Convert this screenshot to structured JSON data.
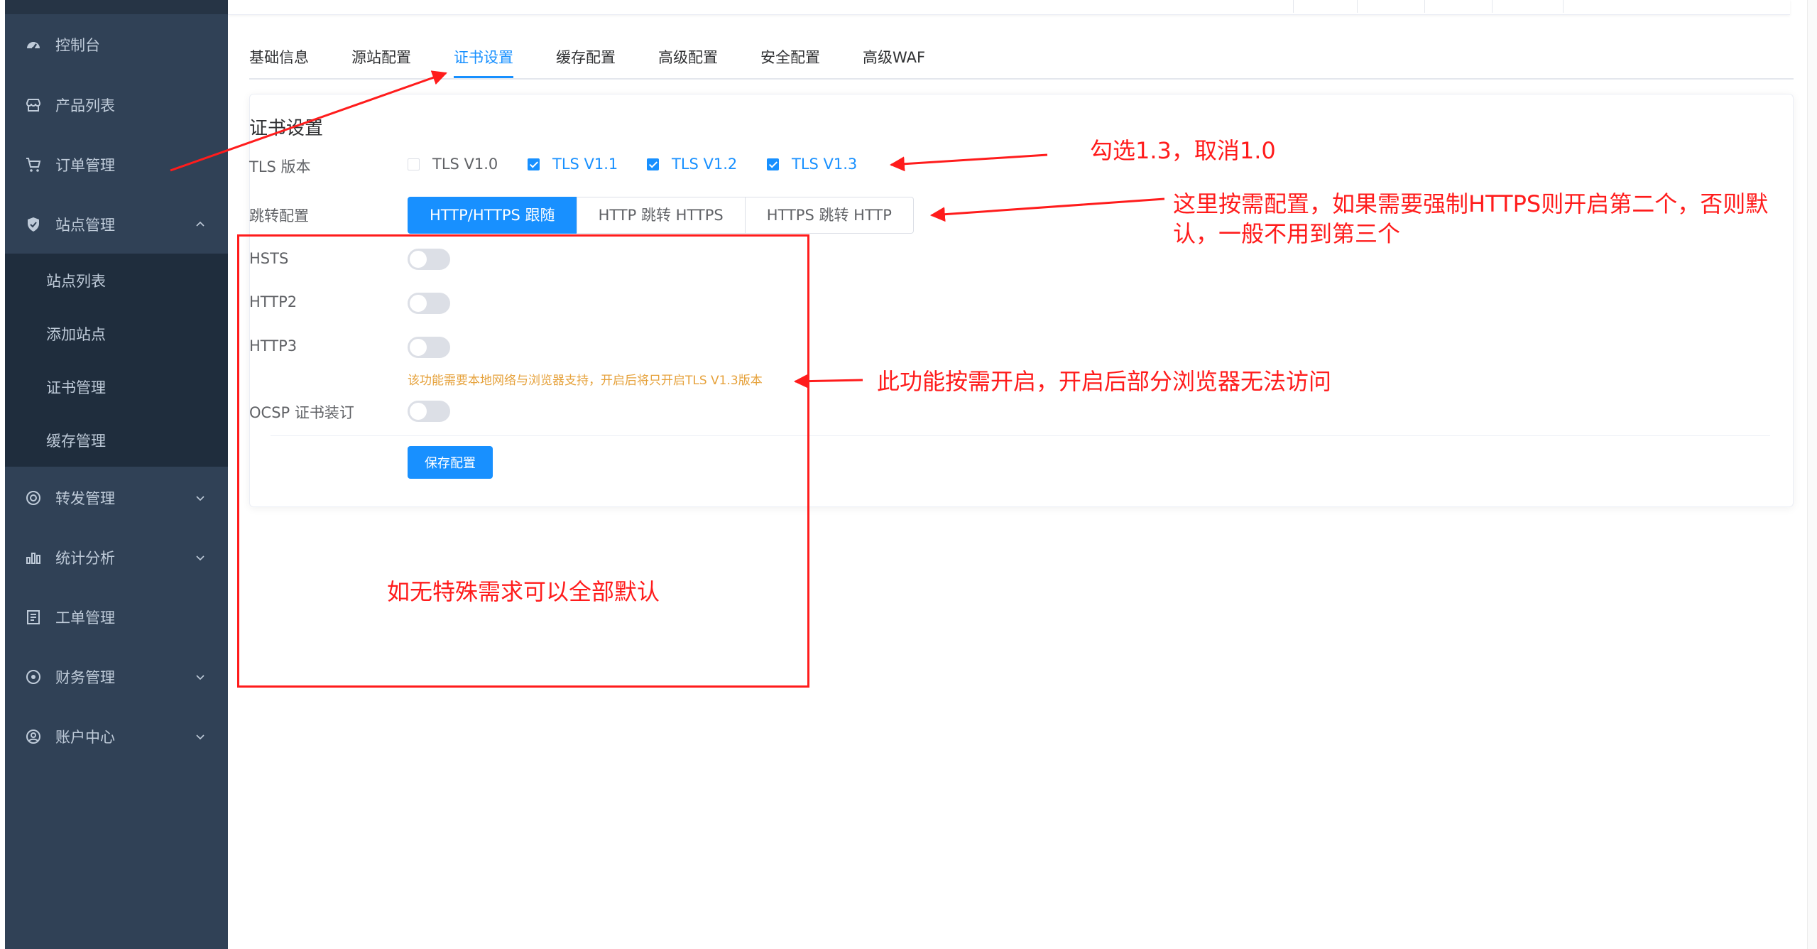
{
  "sidebar": {
    "items": [
      {
        "label": "控制台",
        "icon": "dashboard-icon"
      },
      {
        "label": "产品列表",
        "icon": "shop-icon"
      },
      {
        "label": "订单管理",
        "icon": "cart-icon"
      },
      {
        "label": "站点管理",
        "icon": "shield-icon",
        "arrow": "chevron-up-icon"
      },
      {
        "label": "转发管理",
        "icon": "target-icon",
        "arrow": "chevron-down-icon"
      },
      {
        "label": "统计分析",
        "icon": "bar-chart-icon",
        "arrow": "chevron-down-icon"
      },
      {
        "label": "工单管理",
        "icon": "document-icon"
      },
      {
        "label": "财务管理",
        "icon": "compass-icon",
        "arrow": "chevron-down-icon"
      },
      {
        "label": "账户中心",
        "icon": "user-circle-icon",
        "arrow": "chevron-down-icon"
      }
    ],
    "submenu": [
      {
        "label": "站点列表"
      },
      {
        "label": "添加站点"
      },
      {
        "label": "证书管理"
      },
      {
        "label": "缓存管理"
      }
    ]
  },
  "tabs": [
    {
      "label": "基础信息"
    },
    {
      "label": "源站配置"
    },
    {
      "label": "证书设置",
      "active": true
    },
    {
      "label": "缓存配置"
    },
    {
      "label": "高级配置"
    },
    {
      "label": "安全配置"
    },
    {
      "label": "高级WAF"
    }
  ],
  "form": {
    "title": "证书设置",
    "tls_label": "TLS 版本",
    "tls_options": [
      {
        "label": "TLS V1.0",
        "checked": false
      },
      {
        "label": "TLS V1.1",
        "checked": true
      },
      {
        "label": "TLS V1.2",
        "checked": true
      },
      {
        "label": "TLS V1.3",
        "checked": true
      }
    ],
    "redirect_label": "跳转配置",
    "redirect_options": [
      {
        "label": "HTTP/HTTPS 跟随",
        "active": true
      },
      {
        "label": "HTTP 跳转 HTTPS",
        "active": false
      },
      {
        "label": "HTTPS 跳转 HTTP",
        "active": false
      }
    ],
    "hsts_label": "HSTS",
    "hsts_on": false,
    "http2_label": "HTTP2",
    "http2_on": false,
    "http3_label": "HTTP3",
    "http3_on": false,
    "http3_tip": "该功能需要本地网络与浏览器支持，开启后将只开启TLS V1.3版本",
    "ocsp_label": "OCSP 证书装订",
    "ocsp_on": false,
    "save_label": "保存配置"
  },
  "annotations": {
    "tls_note": "勾选1.3，取消1.0",
    "redirect_note": "这里按需配置，如果需要强制HTTPS则开启第二个，否则默认，一般不用到第三个",
    "http3_note": "此功能按需开启，开启后部分浏览器无法访问",
    "default_note": "如无特殊需求可以全部默认",
    "color": "#ff1c1c"
  },
  "colors": {
    "sidebar_bg": "#304156",
    "submenu_bg": "#1f2d3d",
    "accent": "#1890ff",
    "warning": "#e6a23c"
  }
}
